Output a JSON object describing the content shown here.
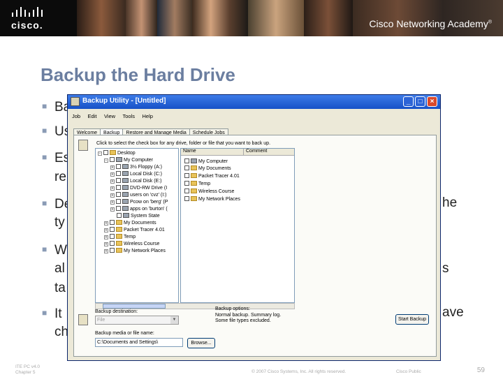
{
  "header": {
    "brand": "cisco.",
    "academy": "Cisco Networking Academy",
    "trademark": "®"
  },
  "slide": {
    "title": "Backup the Hard Drive",
    "bullets": [
      {
        "text": "Ba"
      },
      {
        "text": "Us"
      },
      {
        "text": "Es",
        "cont": "re"
      },
      {
        "text": "De",
        "tail": "he",
        "cont": "ty"
      },
      {
        "text": "W",
        "tail": "s",
        "cont": "al",
        "cont2": "ta"
      },
      {
        "text": "It",
        "tail": "ave",
        "cont": "ch"
      }
    ]
  },
  "window": {
    "title": "Backup Utility - [Untitled]",
    "menu": [
      "Job",
      "Edit",
      "View",
      "Tools",
      "Help"
    ],
    "tabs": [
      "Welcome",
      "Backup",
      "Restore and Manage Media",
      "Schedule Jobs"
    ],
    "active_tab": "Backup",
    "hint": "Click to select the check box for any drive, folder or file that you want to back up.",
    "tree": [
      {
        "label": "Desktop",
        "icon": "folder"
      },
      {
        "label": "My Computer",
        "icon": "drive"
      },
      {
        "label": "3½ Floppy (A:)",
        "icon": "drive"
      },
      {
        "label": "Local Disk (C:)",
        "icon": "drive"
      },
      {
        "label": "Local Disk (E:)",
        "icon": "drive"
      },
      {
        "label": "DVD-RW Drive (I",
        "icon": "drive"
      },
      {
        "label": "users on 'cvz' (I:)",
        "icon": "drive"
      },
      {
        "label": "Pcow on 'berg' (P",
        "icon": "drive"
      },
      {
        "label": "apps on 'burton' (",
        "icon": "drive"
      },
      {
        "label": "System State",
        "icon": "drive"
      },
      {
        "label": "My Documents",
        "icon": "folder"
      },
      {
        "label": "Packet Tracer 4.01",
        "icon": "folder"
      },
      {
        "label": "Temp",
        "icon": "folder"
      },
      {
        "label": "Wireless Course",
        "icon": "folder"
      },
      {
        "label": "My Network Places",
        "icon": "folder"
      }
    ],
    "list_headers": [
      "Name",
      "Comment"
    ],
    "list": [
      {
        "label": "My Computer",
        "icon": "drive"
      },
      {
        "label": "My Documents",
        "icon": "folder"
      },
      {
        "label": "Packet Tracer 4.01",
        "icon": "folder"
      },
      {
        "label": "Temp",
        "icon": "folder"
      },
      {
        "label": "Wireless Course",
        "icon": "folder"
      },
      {
        "label": "My Network Places",
        "icon": "folder"
      }
    ],
    "backup_destination_label": "Backup destination:",
    "backup_destination_value": "File",
    "backup_media_label": "Backup media or file name:",
    "backup_media_value": "C:\\Documents and Settings\\",
    "browse_label": "Browse...",
    "options_label": "Backup options:",
    "options_line1": "Normal backup. Summary log.",
    "options_line2": "Some file types excluded.",
    "start_label": "Start Backup"
  },
  "footer": {
    "course": "ITE PC v4.0",
    "chapter": "Chapter 5",
    "copyright": "© 2007 Cisco Systems, Inc. All rights reserved.",
    "classification": "Cisco Public",
    "page": "59"
  }
}
